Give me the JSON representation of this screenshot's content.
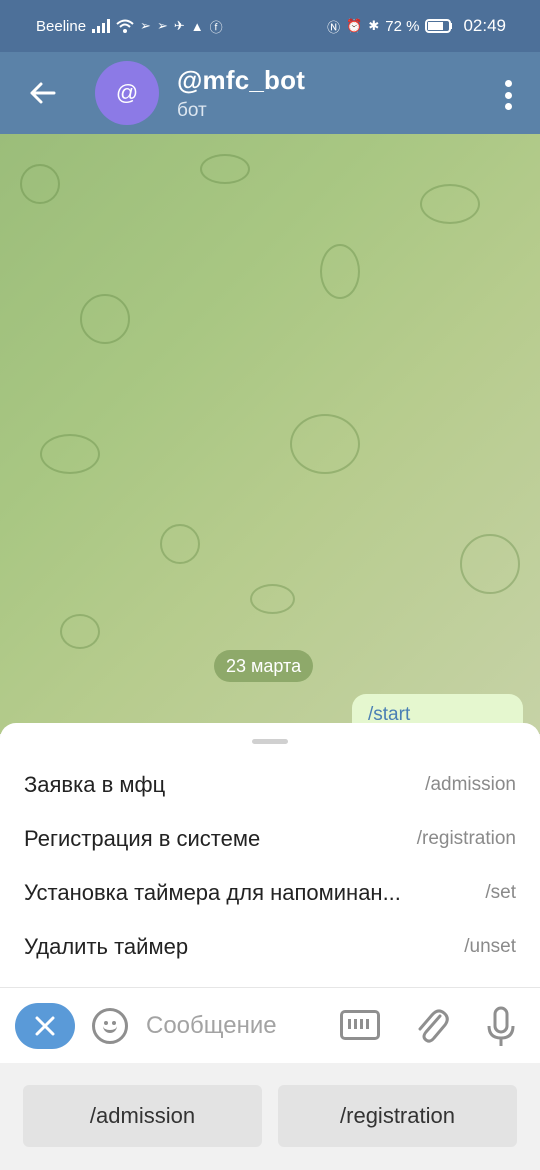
{
  "status_bar": {
    "carrier": "Beeline",
    "battery_percent": "72 %",
    "time": "02:49"
  },
  "header": {
    "avatar_letter": "@",
    "title": "@mfc_bot",
    "subtitle": "бот"
  },
  "chat": {
    "date_separator": "23 марта",
    "message": "/start"
  },
  "commands": [
    {
      "description": "Заявка в мфц",
      "command": "/admission"
    },
    {
      "description": "Регистрация в системе",
      "command": "/registration"
    },
    {
      "description": "Установка таймера для напоминан...",
      "command": "/set"
    },
    {
      "description": "Удалить таймер",
      "command": "/unset"
    }
  ],
  "input": {
    "placeholder": "Сообщение"
  },
  "reply_keyboard": [
    {
      "label": "/admission"
    },
    {
      "label": "/registration"
    }
  ],
  "colors": {
    "header": "#5b82a8",
    "status_bar": "#4d7099",
    "accent": "#5a9ad8",
    "avatar": "#8c7ae6"
  }
}
